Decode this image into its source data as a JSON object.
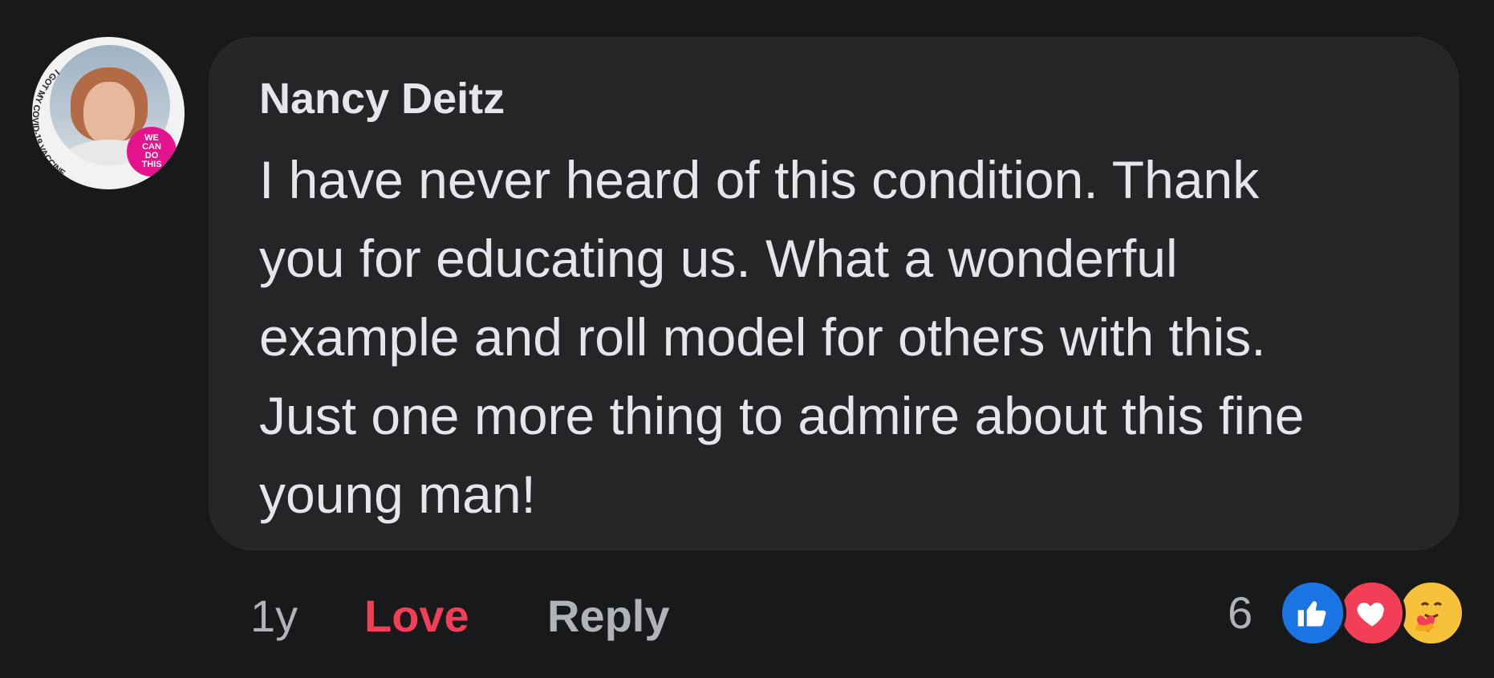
{
  "comment": {
    "avatar": {
      "ring_text": "I GOT MY COVID-19 VACCINE",
      "badge_lines": [
        "WE",
        "CAN",
        "DO",
        "THIS"
      ]
    },
    "author": "Nancy Deitz",
    "text_lines": [
      "I have never heard of this condition. Thank",
      "you for educating us. What a wonderful",
      "example and roll model for others with this.",
      "Just one more thing to admire about this fine",
      "young man!"
    ],
    "timestamp": "1y",
    "love_label": "Love",
    "reply_label": "Reply",
    "reaction_count": "6",
    "reaction_icons": [
      "like-icon",
      "love-icon",
      "care-icon"
    ]
  },
  "colors": {
    "background": "#18191a",
    "bubble": "#242526",
    "text": "#e4e6eb",
    "muted": "#b0b3b8",
    "love": "#f33e58",
    "like": "#1b74e4",
    "care": "#f7c13a"
  }
}
